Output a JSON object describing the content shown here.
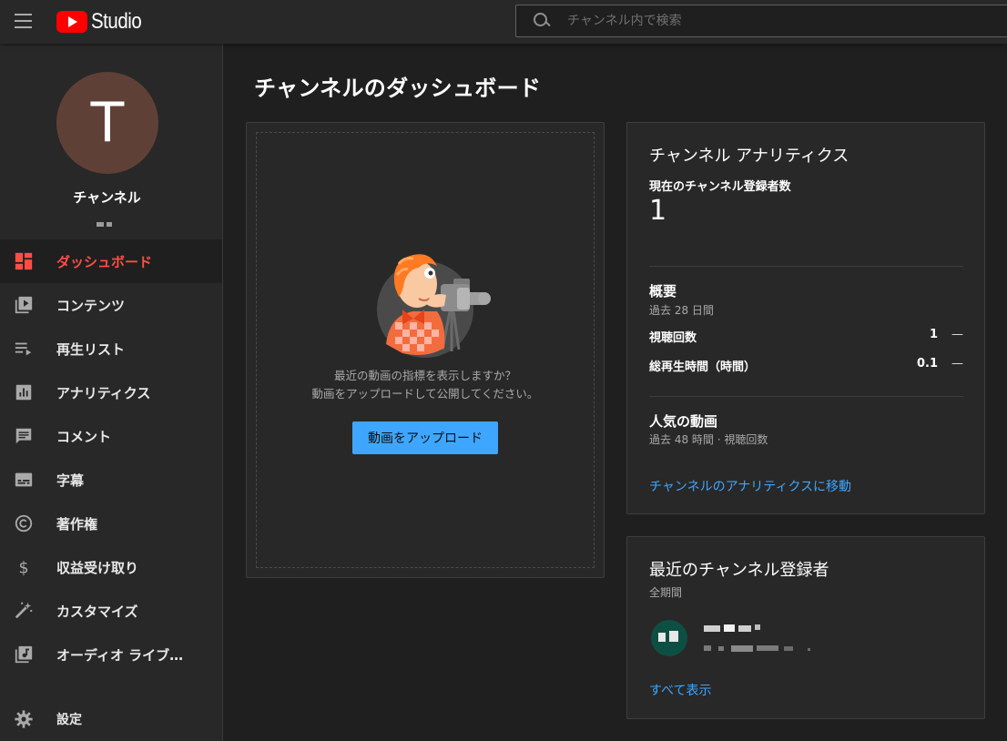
{
  "header": {
    "logo_text": "Studio",
    "search_placeholder": "チャンネル内で検索"
  },
  "sidebar": {
    "avatar_letter": "T",
    "channel_label": "チャンネル",
    "items": [
      {
        "label": "ダッシュボード",
        "icon": "dashboard-icon",
        "active": true
      },
      {
        "label": "コンテンツ",
        "icon": "content-icon"
      },
      {
        "label": "再生リスト",
        "icon": "playlist-icon"
      },
      {
        "label": "アナリティクス",
        "icon": "analytics-icon"
      },
      {
        "label": "コメント",
        "icon": "comment-icon"
      },
      {
        "label": "字幕",
        "icon": "subtitles-icon"
      },
      {
        "label": "著作権",
        "icon": "copyright-icon"
      },
      {
        "label": "収益受け取り",
        "icon": "dollar-icon"
      },
      {
        "label": "カスタマイズ",
        "icon": "magic-wand-icon"
      },
      {
        "label": "オーディオ ライブ…",
        "icon": "audio-library-icon"
      }
    ],
    "settings_label": "設定"
  },
  "main": {
    "title": "チャンネルのダッシュボード",
    "upload_card": {
      "line1": "最近の動画の指標を表示しますか？",
      "line2": "動画をアップロードして公開してください。",
      "button_label": "動画をアップロード"
    },
    "analytics_card": {
      "title": "チャンネル アナリティクス",
      "subscribers_label": "現在のチャンネル登録者数",
      "subscribers_count": "1",
      "summary_title": "概要",
      "summary_period": "過去 28 日間",
      "views_label": "視聴回数",
      "views_value": "1",
      "views_trend": "—",
      "watch_label": "総再生時間（時間）",
      "watch_value": "0.1",
      "watch_trend": "—",
      "popular_title": "人気の動画",
      "popular_period": "過去 48 時間 · 視聴回数",
      "analytics_link": "チャンネルのアナリティクスに移動"
    },
    "subscribers_card": {
      "title": "最近のチャンネル登録者",
      "period": "全期間",
      "show_all_link": "すべて表示"
    }
  },
  "colors": {
    "accent_red": "#ff4e45",
    "link_blue": "#3ea6ff",
    "avatar_bg": "#5f4037"
  }
}
